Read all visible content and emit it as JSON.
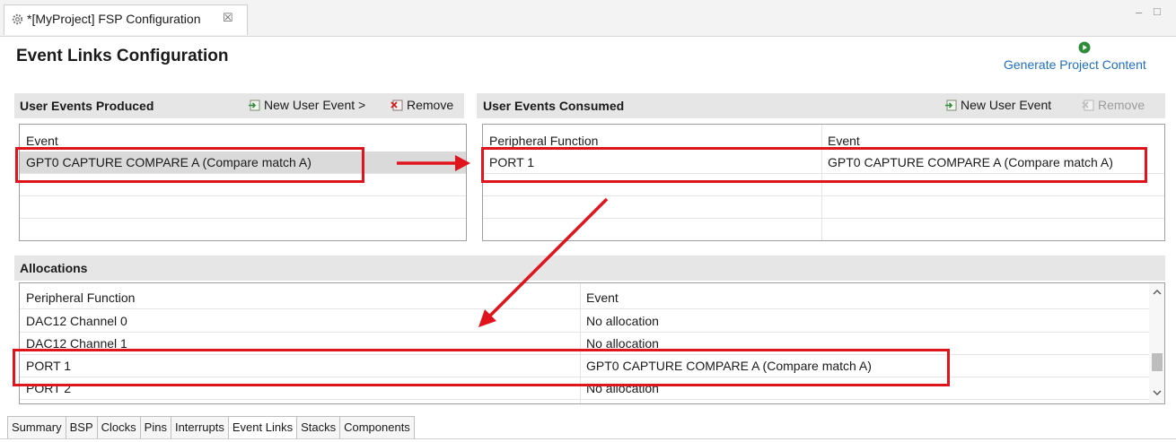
{
  "editor_tab": {
    "title": "*[MyProject] FSP Configuration",
    "close_glyph": "☒"
  },
  "window_controls": {
    "minimize": "–",
    "maximize": "□"
  },
  "header": {
    "title": "Event Links Configuration",
    "generate_label": "Generate Project Content",
    "generate_icon": "play-circle-icon"
  },
  "produced": {
    "title": "User Events Produced",
    "new_label": "New User Event >",
    "remove_label": "Remove",
    "column": "Event",
    "rows": [
      "GPT0 CAPTURE COMPARE A (Compare match A)",
      "",
      "",
      ""
    ]
  },
  "consumed": {
    "title": "User Events Consumed",
    "new_label": "New User Event",
    "remove_label": "Remove",
    "columns": [
      "Peripheral Function",
      "Event"
    ],
    "rows": [
      [
        "PORT 1",
        "GPT0 CAPTURE COMPARE A (Compare match A)"
      ],
      [
        "",
        ""
      ],
      [
        "",
        ""
      ],
      [
        "",
        ""
      ]
    ]
  },
  "allocations": {
    "title": "Allocations",
    "columns": [
      "Peripheral Function",
      "Event"
    ],
    "rows": [
      [
        "DAC12 Channel 0",
        "No allocation"
      ],
      [
        "DAC12 Channel 1",
        "No allocation"
      ],
      [
        "PORT 1",
        "GPT0 CAPTURE COMPARE A (Compare match A)"
      ],
      [
        "PORT 2",
        "No allocation"
      ]
    ]
  },
  "bottom_tabs": [
    "Summary",
    "BSP",
    "Clocks",
    "Pins",
    "Interrupts",
    "Event Links",
    "Stacks",
    "Components"
  ],
  "active_bottom_tab": "Event Links",
  "colors": {
    "highlight": "#e0141c",
    "link": "#1f6fbf",
    "section_bar": "#e6e6e6"
  }
}
